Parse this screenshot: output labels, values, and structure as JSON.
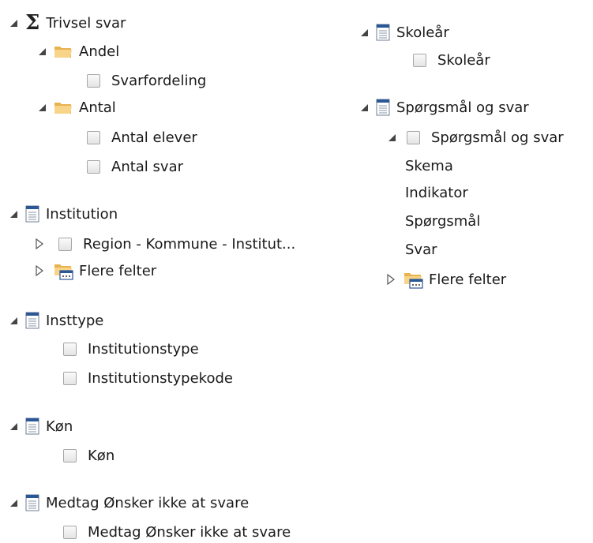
{
  "left_tree": {
    "trivsel": {
      "label": "Trivsel svar",
      "andel": {
        "label": "Andel",
        "items": [
          "Svarfordeling"
        ]
      },
      "antal": {
        "label": "Antal",
        "items": [
          "Antal elever",
          "Antal svar"
        ]
      }
    },
    "institution": {
      "label": "Institution",
      "hierarchy": "Region - Kommune - Institut...",
      "more": "Flere felter"
    },
    "insttype": {
      "label": "Insttype",
      "items": [
        "Institutionstype",
        "Institutionstypekode"
      ]
    },
    "koen": {
      "label": "Køn",
      "items": [
        "Køn"
      ]
    },
    "medtag": {
      "label": "Medtag Ønsker ikke at svare",
      "items": [
        "Medtag Ønsker ikke at svare"
      ]
    }
  },
  "right_tree": {
    "skoleaar": {
      "label": "Skoleår",
      "items": [
        "Skoleår"
      ]
    },
    "spoergsmaal": {
      "label": "Spørgsmål og svar",
      "hierarchy": "Spørgsmål og svar",
      "levels": [
        "Skema",
        "Indikator",
        "Spørgsmål",
        "Svar"
      ],
      "more": "Flere felter"
    }
  },
  "colors": {
    "folder": "#f2c66d",
    "table_icon": "#2b5797",
    "text": "#1a1a1a"
  },
  "icons": {
    "expanded": "expanded-triangle-icon",
    "collapsed": "collapsed-triangle-icon",
    "measure": "sigma-icon",
    "folder": "folder-icon",
    "table": "table-icon",
    "more_fields": "more-fields-folder-icon",
    "checkbox": "checkbox-icon"
  }
}
